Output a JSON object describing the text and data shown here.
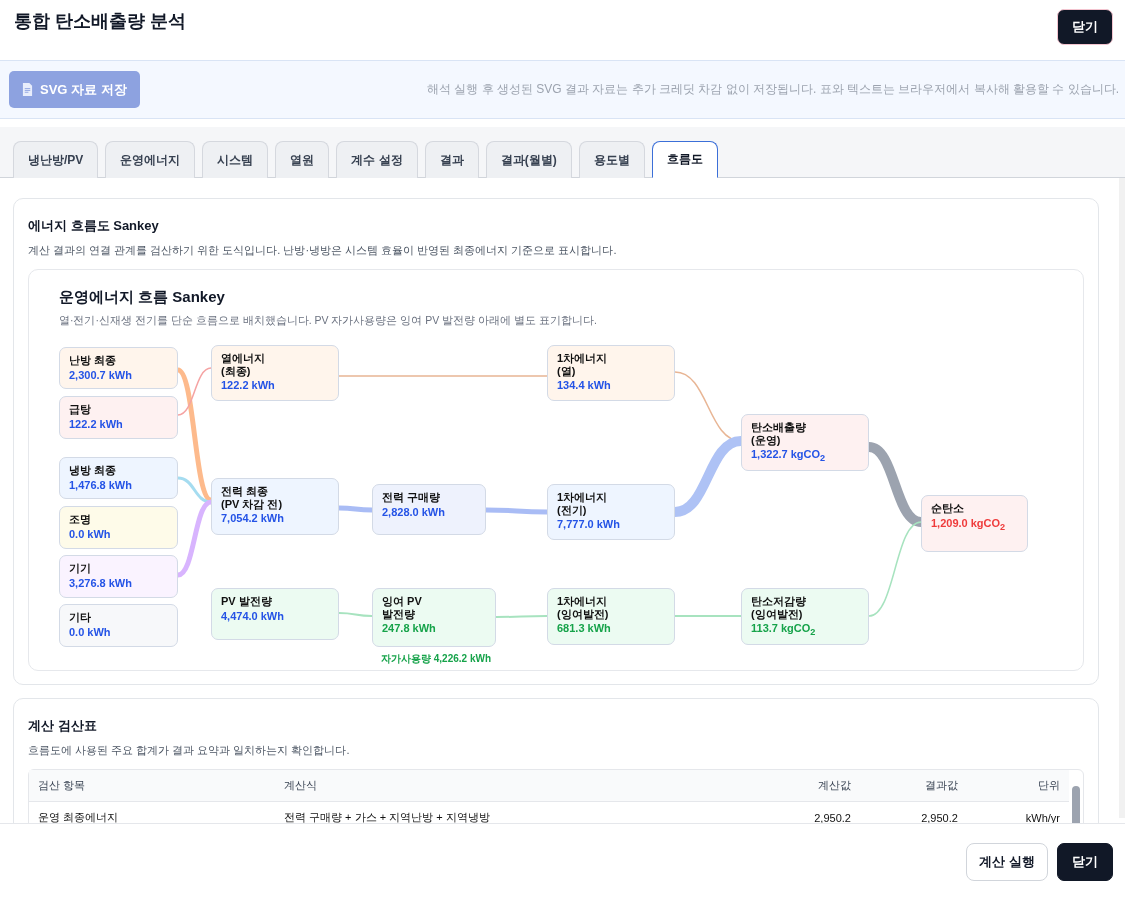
{
  "window": {
    "title": "통합 탄소배출량 분석",
    "close_button": "닫기"
  },
  "toolbar": {
    "save_button": "SVG 자료 저장",
    "hint": "해석 실행 후 생성된 SVG 결과 자료는 추가 크레딧 차감 없이 저장됩니다. 표와 텍스트는 브라우저에서 복사해 활용할 수 있습니다."
  },
  "tabs": [
    {
      "label": "냉난방/PV",
      "selected": false
    },
    {
      "label": "운영에너지",
      "selected": false
    },
    {
      "label": "시스템",
      "selected": false
    },
    {
      "label": "열원",
      "selected": false
    },
    {
      "label": "계수 설정",
      "selected": false
    },
    {
      "label": "결과",
      "selected": false
    },
    {
      "label": "결과(월별)",
      "selected": false
    },
    {
      "label": "용도별",
      "selected": false
    },
    {
      "label": "흐름도",
      "selected": true
    }
  ],
  "sankey_section": {
    "title": "에너지 흐름도 Sankey",
    "description": "계산 결과의 연결 관계를 검산하기 위한 도식입니다. 난방·냉방은 시스템 효율이 반영된 최종에너지 기준으로 표시합니다.",
    "diagram": {
      "title": "운영에너지 흐름 Sankey",
      "subtitle": "열·전기·신재생 전기를 단순 흐름으로 배치했습니다. PV 자가사용량은 잉여 PV 발전량 아래에 별도 표기합니다.",
      "nodes": [
        {
          "label": "난방 최종",
          "value": "2,300.7 kWh",
          "color": "#fff5ec",
          "kind": "energy"
        },
        {
          "label": "급탕",
          "value": "122.2 kWh",
          "color": "#fef1f1",
          "kind": "energy"
        },
        {
          "label": "냉방 최종",
          "value": "1,476.8 kWh",
          "color": "#eef5ff",
          "kind": "energy"
        },
        {
          "label": "조명",
          "value": "0.0 kWh",
          "color": "#fefbe9",
          "kind": "energy"
        },
        {
          "label": "기기",
          "value": "3,276.8 kWh",
          "color": "#faf3ff",
          "kind": "energy"
        },
        {
          "label": "기타",
          "value": "0.0 kWh",
          "color": "#f7f8fa",
          "kind": "energy"
        },
        {
          "label": "열에너지\n(최종)",
          "value": "122.2 kWh",
          "color": "#fff5ec",
          "kind": "energy"
        },
        {
          "label": "전력 최종\n(PV 차감 전)",
          "value": "7,054.2 kWh",
          "color": "#eef5ff",
          "kind": "energy"
        },
        {
          "label": "PV 발전량",
          "value": "4,474.0 kWh",
          "color": "#ecfbf2",
          "kind": "energy"
        },
        {
          "label": "전력 구매량",
          "value": "2,828.0 kWh",
          "color": "#eef2fd",
          "kind": "energy"
        },
        {
          "label": "잉여 PV\n발전량",
          "value": "247.8 kWh",
          "color": "#ecfbf2",
          "kind": "surplus",
          "note": "자가사용량 4,226.2 kWh"
        },
        {
          "label": "1차에너지\n(열)",
          "value": "134.4 kWh",
          "color": "#fff5ec",
          "kind": "energy"
        },
        {
          "label": "1차에너지\n(전기)",
          "value": "7,777.0 kWh",
          "color": "#eef5ff",
          "kind": "energy"
        },
        {
          "label": "1차에너지\n(잉여발전)",
          "value": "681.3 kWh",
          "color": "#ecfbf2",
          "kind": "surplus"
        },
        {
          "label": "탄소배출량\n(운영)",
          "value": "1,322.7 kgCO$_{2}$",
          "color": "#fef1f1",
          "kind": "energy"
        },
        {
          "label": "탄소저감량\n(잉여발전)",
          "value": "113.7 kgCO$_{2}$",
          "color": "#ecfbf2",
          "kind": "surplus"
        },
        {
          "label": "순탄소",
          "value": "1,209.0 kgCO$_{2}$",
          "color": "#fef1f1",
          "kind": "net"
        }
      ]
    }
  },
  "check_section": {
    "title": "계산 검산표",
    "description": "흐름도에 사용된 주요 합계가 결과 요약과 일치하는지 확인합니다.",
    "table": {
      "columns": [
        "검산 항목",
        "계산식",
        "계산값",
        "결과값",
        "단위"
      ],
      "rows": [
        [
          "운영 최종에너지",
          "전력 구매량 + 가스 + 지역난방 + 지역냉방",
          "2,950.2",
          "2,950.2",
          "kWh/yr"
        ]
      ]
    }
  },
  "footer": {
    "run_button": "계산 실행",
    "close_button": "닫기"
  }
}
